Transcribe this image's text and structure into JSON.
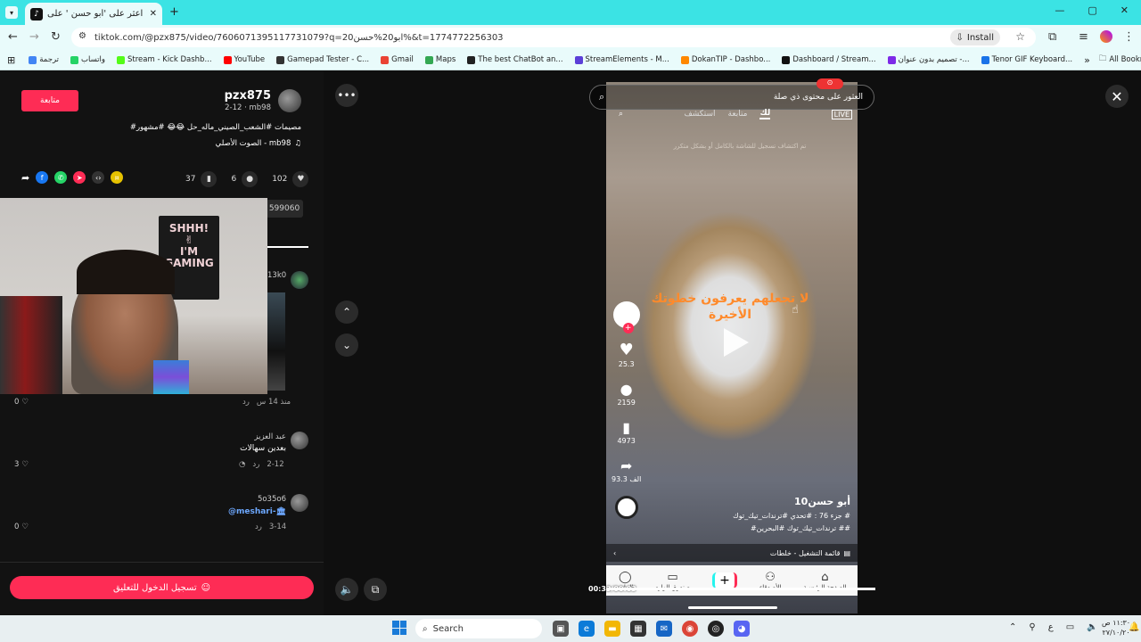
{
  "browser": {
    "tab_title": "اعثر على 'أبو حسن ' على TikTok",
    "url": "tiktok.com/@pzx875/video/7606071395117731079?q=ابو20%حسن20%&t=1774772256303",
    "install_label": "Install",
    "all_bookmarks": "All Bookmarks",
    "bookmarks": [
      "ترجمة",
      "واتساب",
      "Stream - Kick Dashb...",
      "YouTube",
      "Gamepad Tester - C...",
      "Gmail",
      "Maps",
      "The best ChatBot an...",
      "StreamElements - M...",
      "DokanTIP - Dashbo...",
      "Dashboard / Stream...",
      "تصميم بدون عنوان -...",
      "Tenor GIF Keyboard..."
    ],
    "bookmark_colors": [
      "#4285f4",
      "#25d366",
      "#53fc18",
      "#ff0000",
      "#333333",
      "#ea4335",
      "#34a853",
      "#222222",
      "#5b3fd8",
      "#ff8800",
      "#111111",
      "#7d2ae8",
      "#1a73e8"
    ]
  },
  "post": {
    "username": "pzx875",
    "subline": "2-12 · mb98",
    "follow_label": "متابعة",
    "caption": "#مصيمات #الشعب_الصيني_ماله_حل 😂😂 #مشهور",
    "sound": "الصوت الأصلي - mb98",
    "likes": "102",
    "comments": "6",
    "saves": "37",
    "partial_count": "599060",
    "comment_count_top": "13k0"
  },
  "comments": [
    {
      "time": "منذ 14 س",
      "reply": "رد",
      "likes": "0"
    },
    {
      "user": "عبد العزيز",
      "text": "بعدين سهالات",
      "date": "2-12",
      "reply": "رد",
      "likes": "3"
    },
    {
      "user": "5o35o6",
      "text": "@meshari-🏛",
      "date": "3-14",
      "reply": "رد",
      "likes": "0"
    }
  ],
  "login_label": "تسجيل الدخول للتعليق",
  "video": {
    "search_text": "العثور على محتوى ذي صلة",
    "tabs": [
      "لك",
      "متابعة",
      "استكشف",
      "LIVE"
    ],
    "notice_text": "تم اكتشاف تسجيل للشاشة بالكامل أو بشكل متكرر",
    "overlay_text": "لا تجعلهم يعرفون خطوتك الأخيرة",
    "likes": "25.3",
    "comments": "2159",
    "saves": "4973",
    "shares": "93.3 الف",
    "author": "أبو حسن10",
    "desc1": "جزء 76 : #تحدي #ترندات_تيك_توك #",
    "desc2": "#ترندات_تيك_توك #البحرين ##",
    "playlist": "قائمة التشغيل - خلطات",
    "time": "00:33/00:03",
    "nav": [
      "الصفحة الرئيسية",
      "الأصدقاء",
      "",
      "صندوق الوارد",
      "الملف"
    ]
  },
  "taskbar": {
    "search": "Search",
    "clock_time": "١١:٣٠ ص",
    "clock_date": "٢٧/١٠/٢٠",
    "lang": "ع"
  }
}
